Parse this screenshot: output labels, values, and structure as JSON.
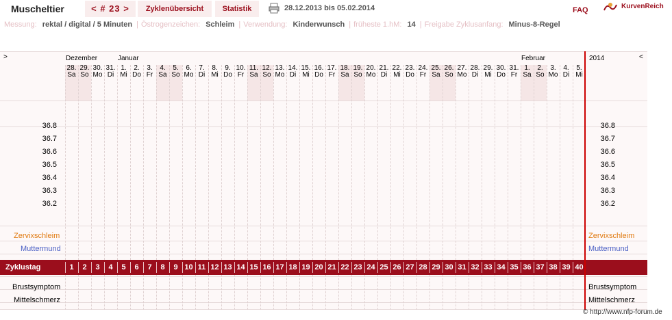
{
  "header": {
    "brand": "Muscheltier",
    "nav": "< # 23 >",
    "tab_cycles": "Zyklenübersicht",
    "tab_stats": "Statistik",
    "date_range": "28.12.2013 bis 05.02.2014",
    "faq": "FAQ",
    "logo": "KurvenReich"
  },
  "info": [
    {
      "label": "Messung:",
      "value": "rektal / digital / 5 Minuten"
    },
    {
      "label": "Östrogenzeichen:",
      "value": "Schleim"
    },
    {
      "label": "Verwendung:",
      "value": "Kinderwunsch"
    },
    {
      "label": "früheste 1.hM:",
      "value": "14"
    },
    {
      "label": "Freigabe Zyklusanfang:",
      "value": "Minus-8-Regel"
    }
  ],
  "chart": {
    "arrow_left": ">",
    "arrow_right": "<",
    "year": "2014",
    "months": [
      {
        "label": "Dezember",
        "day_index": 0
      },
      {
        "label": "Januar",
        "day_index": 4
      },
      {
        "label": "Februar",
        "day_index": 35
      }
    ],
    "days": [
      {
        "d": "28.",
        "w": "Sa"
      },
      {
        "d": "29.",
        "w": "So"
      },
      {
        "d": "30.",
        "w": "Mo"
      },
      {
        "d": "31.",
        "w": "Di"
      },
      {
        "d": "1.",
        "w": "Mi"
      },
      {
        "d": "2.",
        "w": "Do"
      },
      {
        "d": "3.",
        "w": "Fr"
      },
      {
        "d": "4.",
        "w": "Sa"
      },
      {
        "d": "5.",
        "w": "So"
      },
      {
        "d": "6.",
        "w": "Mo"
      },
      {
        "d": "7.",
        "w": "Di"
      },
      {
        "d": "8.",
        "w": "Mi"
      },
      {
        "d": "9.",
        "w": "Do"
      },
      {
        "d": "10.",
        "w": "Fr"
      },
      {
        "d": "11.",
        "w": "Sa"
      },
      {
        "d": "12.",
        "w": "So"
      },
      {
        "d": "13.",
        "w": "Mo"
      },
      {
        "d": "14.",
        "w": "Di"
      },
      {
        "d": "15.",
        "w": "Mi"
      },
      {
        "d": "16.",
        "w": "Do"
      },
      {
        "d": "17.",
        "w": "Fr"
      },
      {
        "d": "18.",
        "w": "Sa"
      },
      {
        "d": "19.",
        "w": "So"
      },
      {
        "d": "20.",
        "w": "Mo"
      },
      {
        "d": "21.",
        "w": "Di"
      },
      {
        "d": "22.",
        "w": "Mi"
      },
      {
        "d": "23.",
        "w": "Do"
      },
      {
        "d": "24.",
        "w": "Fr"
      },
      {
        "d": "25.",
        "w": "Sa"
      },
      {
        "d": "26.",
        "w": "So"
      },
      {
        "d": "27.",
        "w": "Mo"
      },
      {
        "d": "28.",
        "w": "Di"
      },
      {
        "d": "29.",
        "w": "Mi"
      },
      {
        "d": "30.",
        "w": "Do"
      },
      {
        "d": "31.",
        "w": "Fr"
      },
      {
        "d": "1.",
        "w": "Sa"
      },
      {
        "d": "2.",
        "w": "So"
      },
      {
        "d": "3.",
        "w": "Mo"
      },
      {
        "d": "4.",
        "w": "Di"
      },
      {
        "d": "5.",
        "w": "Mi"
      }
    ],
    "temperatures": [
      "36.8",
      "36.7",
      "36.6",
      "36.5",
      "36.4",
      "36.3",
      "36.2"
    ],
    "rows": {
      "zervix": "Zervixschleim",
      "muttermund": "Muttermund",
      "zyklustag": "Zyklustag",
      "brust": "Brustsymptom",
      "mittel": "Mittelschmerz"
    },
    "cycle_days": [
      "1",
      "2",
      "3",
      "4",
      "5",
      "6",
      "7",
      "8",
      "9",
      "10",
      "11",
      "12",
      "13",
      "14",
      "15",
      "16",
      "17",
      "18",
      "19",
      "20",
      "21",
      "22",
      "23",
      "24",
      "25",
      "26",
      "27",
      "28",
      "29",
      "30",
      "31",
      "32",
      "33",
      "34",
      "35",
      "36",
      "37",
      "38",
      "39",
      "40"
    ],
    "colors": {
      "accent": "#9b0e1c",
      "zervix": "#e07a10",
      "muttermund": "#4a5fc4",
      "weekend": "#f5e6e6"
    }
  },
  "footer": "© http://www.nfp-forum.de"
}
